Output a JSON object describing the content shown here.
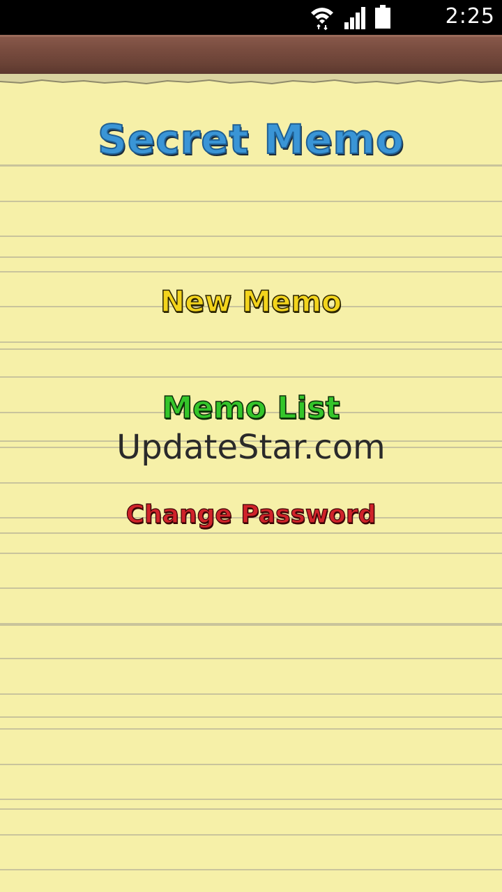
{
  "status_bar": {
    "time": "2:25",
    "icons": [
      "wifi-icon",
      "signal-icon",
      "battery-icon"
    ]
  },
  "app": {
    "title": "Secret Memo",
    "title_color": "#3a95d6"
  },
  "menu": {
    "new_memo": "New Memo",
    "memo_list": "Memo List",
    "change_password": "Change Password",
    "colors": {
      "new_memo": "#f3d41c",
      "memo_list": "#34c52a",
      "change_password": "#d0232a"
    }
  },
  "watermark": {
    "text": "UpdateStar.com"
  },
  "theme": {
    "paper": "#f6f0a8",
    "wood": "#7a4d40",
    "line": "#c8c39a"
  }
}
